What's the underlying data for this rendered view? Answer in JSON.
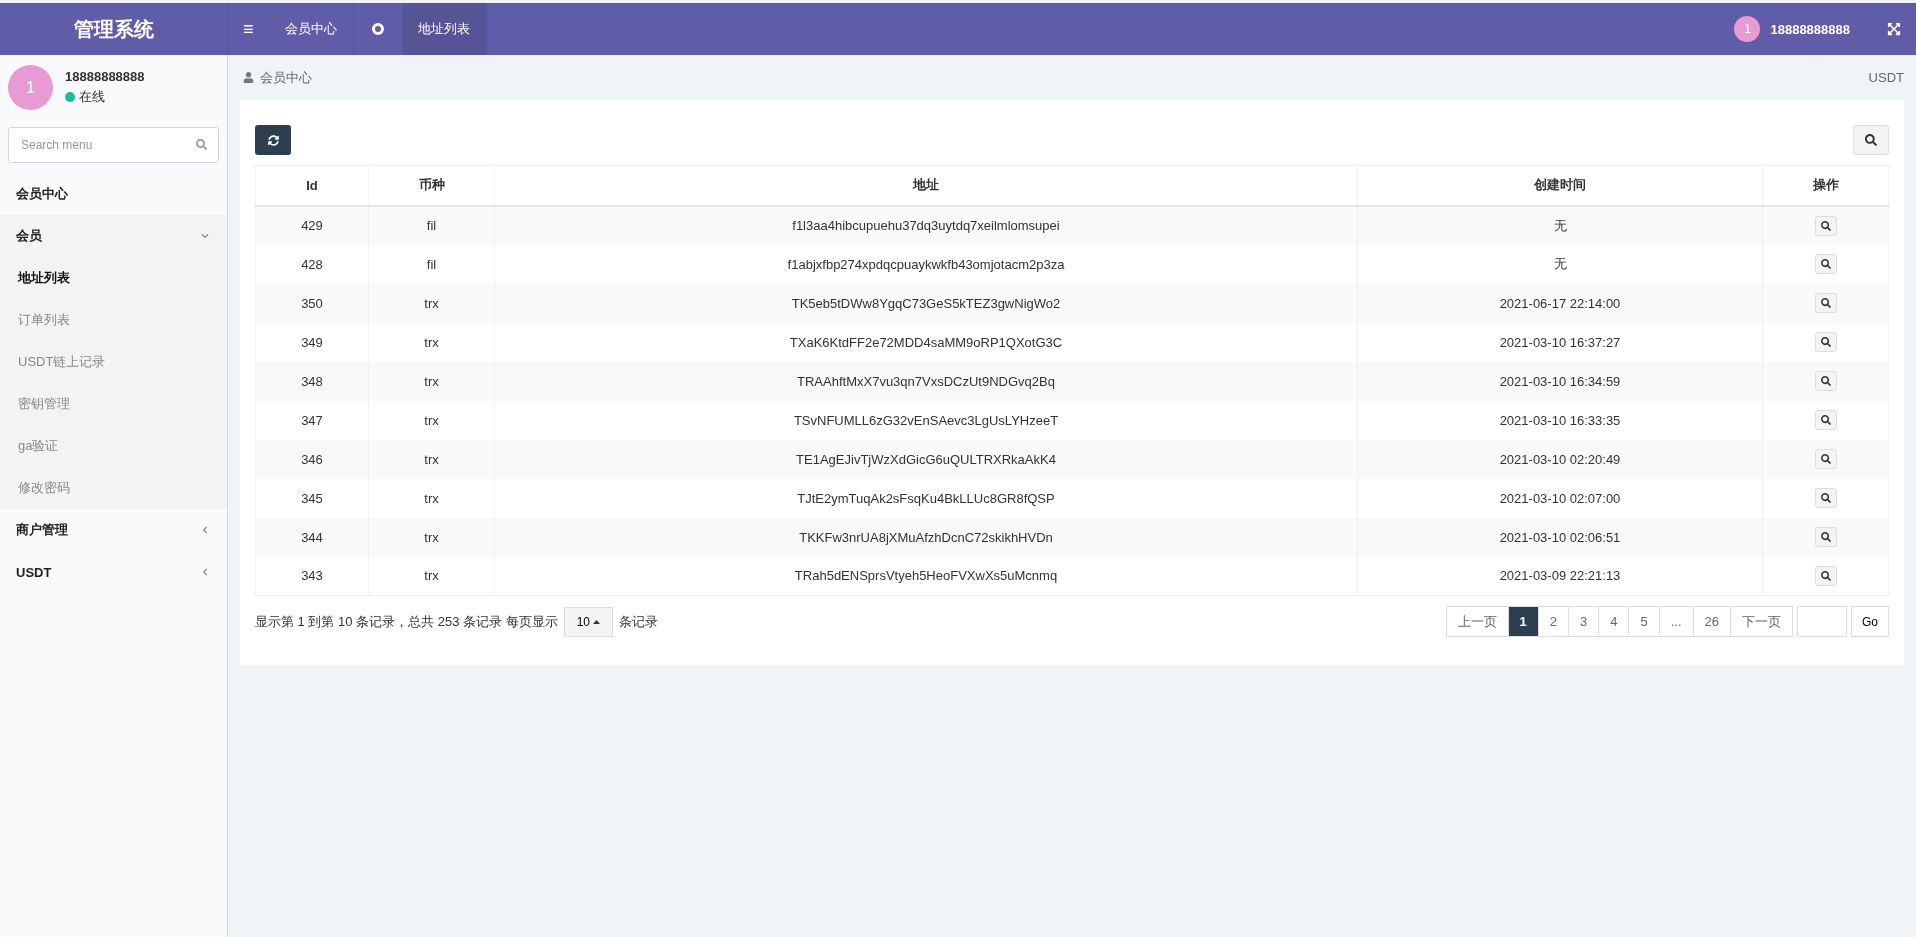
{
  "header": {
    "brand": "管理系统",
    "menu_icon": "≡",
    "tabs": [
      {
        "label": "会员中心",
        "selected": false
      },
      {
        "label": "地址列表",
        "selected": true
      }
    ],
    "user_badge": "1",
    "user_name": "18888888888"
  },
  "sidebar": {
    "avatar": "1",
    "user_name": "18888888888",
    "status": "在线",
    "search": {
      "placeholder": "Search menu"
    },
    "items": [
      {
        "label": "会员中心",
        "kind": "link"
      },
      {
        "label": "会员",
        "kind": "group",
        "expanded": true,
        "children": [
          {
            "label": "地址列表",
            "selected": true
          },
          {
            "label": "订单列表",
            "selected": false
          },
          {
            "label": "USDT链上记录",
            "selected": false
          },
          {
            "label": "密钥管理",
            "selected": false
          },
          {
            "label": "ga验证",
            "selected": false
          },
          {
            "label": "修改密码",
            "selected": false
          }
        ]
      },
      {
        "label": "商户管理",
        "kind": "group",
        "expanded": false
      },
      {
        "label": "USDT",
        "kind": "group",
        "expanded": false
      }
    ]
  },
  "breadcrumb": {
    "current": "会员中心",
    "right": "USDT"
  },
  "table": {
    "columns": [
      "Id",
      "币种",
      "地址",
      "创建时间",
      "操作"
    ],
    "rows": [
      [
        "429",
        "fil",
        "f1l3aa4hibcupuehu37dq3uytdq7xeilmlomsupei",
        "无"
      ],
      [
        "428",
        "fil",
        "f1abjxfbp274xpdqcpuaykwkfb43omjotacm2p3za",
        "无"
      ],
      [
        "350",
        "trx",
        "TK5eb5tDWw8YgqC73GeS5kTEZ3gwNigWo2",
        "2021-06-17 22:14:00"
      ],
      [
        "349",
        "trx",
        "TXaK6KtdFF2e72MDD4saMM9oRP1QXotG3C",
        "2021-03-10 16:37:27"
      ],
      [
        "348",
        "trx",
        "TRAAhftMxX7vu3qn7VxsDCzUt9NDGvq2Bq",
        "2021-03-10 16:34:59"
      ],
      [
        "347",
        "trx",
        "TSvNFUMLL6zG32vEnSAevc3LgUsLYHzeeT",
        "2021-03-10 16:33:35"
      ],
      [
        "346",
        "trx",
        "TE1AgEJivTjWzXdGicG6uQULTRXRkaAkK4",
        "2021-03-10 02:20:49"
      ],
      [
        "345",
        "trx",
        "TJtE2ymTuqAk2sFsqKu4BkLLUc8GR8fQSP",
        "2021-03-10 02:07:00"
      ],
      [
        "344",
        "trx",
        "TKKFw3nrUA8jXMuAfzhDcnC72skikhHVDn",
        "2021-03-10 02:06:51"
      ],
      [
        "343",
        "trx",
        "TRah5dENSprsVtyeh5HeoFVXwXs5uMcnmq",
        "2021-03-09 22:21:13"
      ]
    ]
  },
  "footer": {
    "summary_before": "显示第 1 到第 10 条记录，总共 253 条记录 每页显示",
    "page_size": "10",
    "summary_after": "条记录",
    "pages": [
      {
        "label": "上一页",
        "selected": false
      },
      {
        "label": "1",
        "selected": true
      },
      {
        "label": "2",
        "selected": false
      },
      {
        "label": "3",
        "selected": false
      },
      {
        "label": "4",
        "selected": false
      },
      {
        "label": "5",
        "selected": false
      },
      {
        "label": "...",
        "selected": false
      },
      {
        "label": "26",
        "selected": false
      },
      {
        "label": "下一页",
        "selected": false
      }
    ],
    "go": "Go"
  }
}
